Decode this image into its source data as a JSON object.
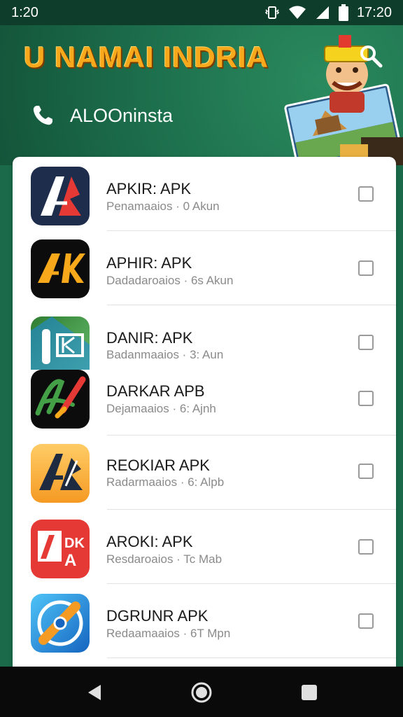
{
  "status_bar": {
    "left_time": "1:20",
    "right_time": "17:20",
    "icons": [
      "vibrate-icon",
      "wifi-icon",
      "signal-icon",
      "battery-icon"
    ]
  },
  "header": {
    "title": "U NAMAI INDRIA",
    "phone_label": "ALOOninsta",
    "colors": {
      "title": "#f7a81b",
      "background": "#1b6b4a"
    }
  },
  "apps": [
    {
      "name": "APKIR: APK",
      "subtitle": "Penamaaios · 0 Akun",
      "icon": "ar-logo-icon",
      "icon_text": "AR",
      "checked": false
    },
    {
      "name": "APHIR: APK",
      "subtitle": "Dadadaroaios · 6s Akun",
      "icon": "ak-logo-icon",
      "icon_text": "AK",
      "checked": false
    },
    {
      "name": "DANIR: APK",
      "subtitle": "Badanmaaios · 3: Aun",
      "icon": "green-k-logo-icon",
      "icon_text": "K",
      "checked": false
    },
    {
      "name": "DARKAR APB",
      "subtitle": "Dejamaaios · 6: Ajnh",
      "icon": "a-brush-logo-icon",
      "icon_text": "A",
      "checked": false
    },
    {
      "name": "REOKIAR APK",
      "subtitle": "Radarmaaios · 6: Alpb",
      "icon": "orange-ar-logo-icon",
      "icon_text": "AR",
      "checked": false
    },
    {
      "name": "AROKI: APK",
      "subtitle": "Resdaroaios · Tc Mab",
      "icon": "red-dka-logo-icon",
      "icon_text": "DKA",
      "checked": false
    },
    {
      "name": "DGRUNR APK",
      "subtitle": "Redaamaaios · 6T Mpn",
      "icon": "blue-compass-logo-icon",
      "icon_text": "",
      "checked": false
    }
  ],
  "nav": {
    "buttons": [
      "back-icon",
      "home-icon",
      "recents-icon"
    ]
  }
}
